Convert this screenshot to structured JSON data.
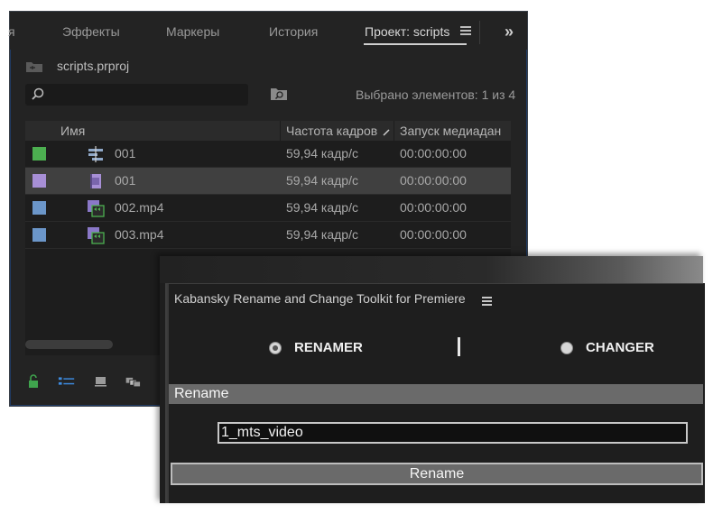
{
  "project_panel": {
    "tabs": [
      {
        "label": "я"
      },
      {
        "label": "Эффекты"
      },
      {
        "label": "Маркеры"
      },
      {
        "label": "История"
      },
      {
        "label": "Проект: scripts"
      }
    ],
    "overflow_icon": "double-chevron-right-icon",
    "project_file": "scripts.prproj",
    "search_placeholder": "",
    "selection_status": "Выбрано элементов: 1 из 4",
    "columns": {
      "name": "Имя",
      "frame_rate": "Частота кадров",
      "media_start": "Запуск медиадан"
    },
    "rows": [
      {
        "color": "#4caf50",
        "icon": "sequence-icon",
        "name": "001",
        "fps": "59,94 кадр/с",
        "start": "00:00:00:00",
        "selected": false
      },
      {
        "color": "#a78fd6",
        "icon": "clip-icon",
        "name": "001",
        "fps": "59,94 кадр/с",
        "start": "00:00:00:00",
        "selected": true
      },
      {
        "color": "#6b96c9",
        "icon": "video-file-icon",
        "name": "002.mp4",
        "fps": "59,94 кадр/с",
        "start": "00:00:00:00",
        "selected": false
      },
      {
        "color": "#6b96c9",
        "icon": "video-file-icon",
        "name": "003.mp4",
        "fps": "59,94 кадр/с",
        "start": "00:00:00:00",
        "selected": false
      }
    ]
  },
  "kabansky": {
    "title": "Kabansky Rename and Change Toolkit for Premiere",
    "mode_renamer": "RENAMER",
    "mode_changer": "CHANGER",
    "selected_mode": "RENAMER",
    "section_title": "Rename",
    "input_value": "1_mts_video",
    "button_label": "Rename"
  }
}
